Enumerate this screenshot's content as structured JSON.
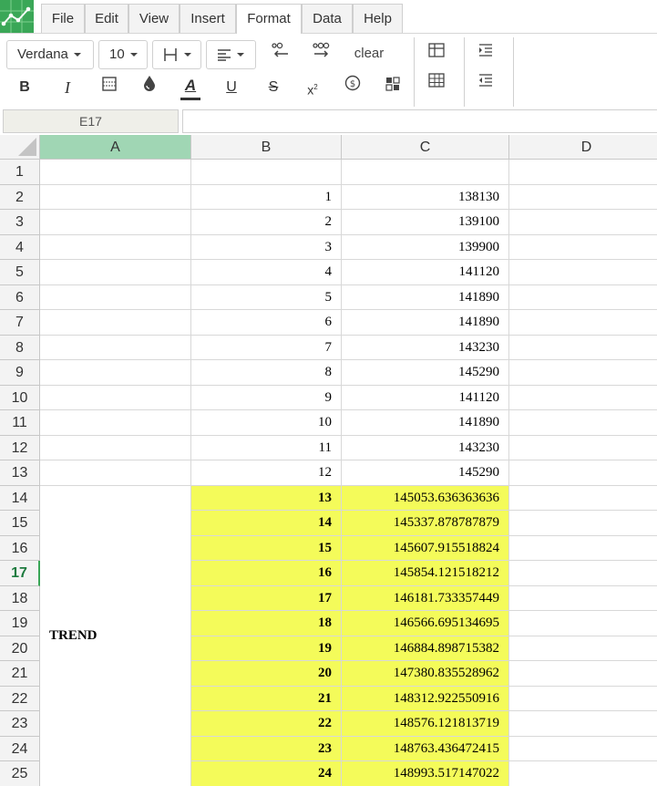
{
  "menu": {
    "items": [
      {
        "label": "File",
        "active": false
      },
      {
        "label": "Edit",
        "active": false
      },
      {
        "label": "View",
        "active": false
      },
      {
        "label": "Insert",
        "active": false
      },
      {
        "label": "Format",
        "active": true
      },
      {
        "label": "Data",
        "active": false
      },
      {
        "label": "Help",
        "active": false
      }
    ]
  },
  "toolbar": {
    "font_family": "Verdana",
    "font_size": "10",
    "clear_label": "clear"
  },
  "formula_bar": {
    "cell_reference": "E17",
    "formula_value": ""
  },
  "columns": [
    "A",
    "B",
    "C",
    "D"
  ],
  "selected_column": "A",
  "selected_row": 17,
  "rows": [
    {
      "num": "1",
      "b": "",
      "c": ""
    },
    {
      "num": "2",
      "b": "1",
      "c": "138130"
    },
    {
      "num": "3",
      "b": "2",
      "c": "139100"
    },
    {
      "num": "4",
      "b": "3",
      "c": "139900"
    },
    {
      "num": "5",
      "b": "4",
      "c": "141120"
    },
    {
      "num": "6",
      "b": "5",
      "c": "141890"
    },
    {
      "num": "7",
      "b": "6",
      "c": "141890"
    },
    {
      "num": "8",
      "b": "7",
      "c": "143230"
    },
    {
      "num": "9",
      "b": "8",
      "c": "145290"
    },
    {
      "num": "10",
      "b": "9",
      "c": "141120"
    },
    {
      "num": "11",
      "b": "10",
      "c": "141890"
    },
    {
      "num": "12",
      "b": "11",
      "c": "143230"
    },
    {
      "num": "13",
      "b": "12",
      "c": "145290"
    },
    {
      "num": "14",
      "b": "13",
      "c": "145053.636363636"
    },
    {
      "num": "15",
      "b": "14",
      "c": "145337.878787879"
    },
    {
      "num": "16",
      "b": "15",
      "c": "145607.915518824"
    },
    {
      "num": "17",
      "b": "16",
      "c": "145854.121518212"
    },
    {
      "num": "18",
      "b": "17",
      "c": "146181.733357449"
    },
    {
      "num": "19",
      "b": "18",
      "c": "146566.695134695"
    },
    {
      "num": "20",
      "b": "19",
      "c": "146884.898715382"
    },
    {
      "num": "21",
      "b": "20",
      "c": "147380.835528962"
    },
    {
      "num": "22",
      "b": "21",
      "c": "148312.922550916"
    },
    {
      "num": "23",
      "b": "22",
      "c": "148576.121813719"
    },
    {
      "num": "24",
      "b": "23",
      "c": "148763.436472415"
    },
    {
      "num": "25",
      "b": "24",
      "c": "148993.517147022"
    }
  ],
  "merged_label": "TREND",
  "highlight_color": "#f4fb5a"
}
